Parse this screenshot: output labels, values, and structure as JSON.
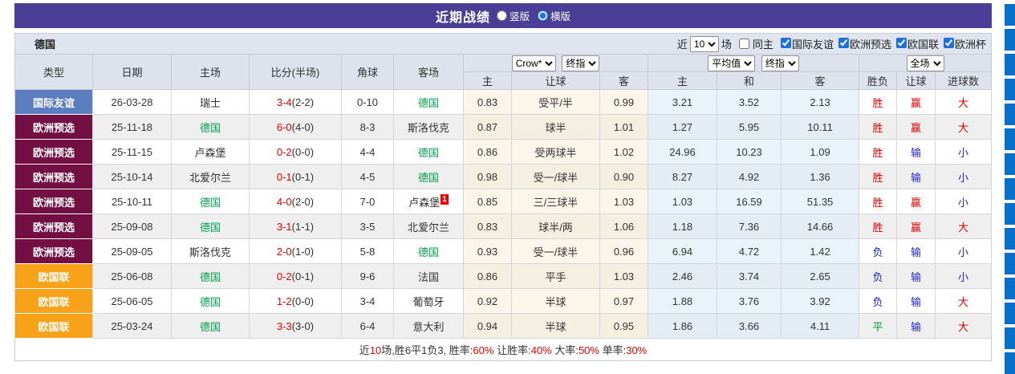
{
  "header": {
    "title": "近期战绩",
    "radio_vertical": "竖版",
    "radio_horizontal": "横版",
    "selected": "横版"
  },
  "filter": {
    "team": "德国",
    "recent_label": "近",
    "matches_value": "10",
    "matches_label": "场",
    "same_home": {
      "label": "同主",
      "checked": false
    },
    "leagues": [
      {
        "label": "国际友谊",
        "checked": true
      },
      {
        "label": "欧洲预选",
        "checked": true
      },
      {
        "label": "欧国联",
        "checked": true
      },
      {
        "label": "欧洲杯",
        "checked": true
      }
    ]
  },
  "table": {
    "columns": {
      "type": "类型",
      "date": "日期",
      "home": "主场",
      "score": "比分(半场)",
      "corner": "角球",
      "away": "客场"
    },
    "group_selects": {
      "bookmaker": "Crow*",
      "final1": "终指",
      "average": "平均值",
      "final2": "终指",
      "scope": "全场"
    },
    "sub_headers": [
      "主",
      "让球",
      "客",
      "主",
      "和",
      "客",
      "胜负",
      "让球",
      "进球数"
    ],
    "type_colors": {
      "国际友谊": "#5b7ec1",
      "欧洲预选": "#740f44",
      "欧国联": "#f7a218"
    },
    "rows": [
      {
        "type": "国际友谊",
        "date": "26-03-28",
        "home": "瑞士",
        "home_green": false,
        "score": "3-4",
        "half": "(2-2)",
        "corner": "0-10",
        "away": "德国",
        "away_green": true,
        "away_red_card": "",
        "odds": [
          "0.83",
          "受平/半",
          "0.99"
        ],
        "avg": [
          "3.21",
          "3.52",
          "2.13"
        ],
        "results": [
          {
            "t": "胜",
            "c": "r"
          },
          {
            "t": "赢",
            "c": "r"
          },
          {
            "t": "大",
            "c": "r"
          }
        ]
      },
      {
        "type": "欧洲预选",
        "date": "25-11-18",
        "home": "德国",
        "home_green": true,
        "score": "6-0",
        "half": "(4-0)",
        "corner": "8-3",
        "away": "斯洛伐克",
        "away_green": false,
        "away_red_card": "",
        "odds": [
          "0.87",
          "球半",
          "1.01"
        ],
        "avg": [
          "1.27",
          "5.95",
          "10.11"
        ],
        "results": [
          {
            "t": "胜",
            "c": "r"
          },
          {
            "t": "赢",
            "c": "r"
          },
          {
            "t": "大",
            "c": "r"
          }
        ]
      },
      {
        "type": "欧洲预选",
        "date": "25-11-15",
        "home": "卢森堡",
        "home_green": false,
        "score": "0-2",
        "half": "(0-0)",
        "corner": "4-4",
        "away": "德国",
        "away_green": true,
        "away_red_card": "",
        "odds": [
          "0.86",
          "受两球半",
          "1.02"
        ],
        "avg": [
          "24.96",
          "10.23",
          "1.09"
        ],
        "results": [
          {
            "t": "胜",
            "c": "r"
          },
          {
            "t": "输",
            "c": "b"
          },
          {
            "t": "小",
            "c": "b"
          }
        ]
      },
      {
        "type": "欧洲预选",
        "date": "25-10-14",
        "home": "北爱尔兰",
        "home_green": false,
        "score": "0-1",
        "half": "(0-1)",
        "corner": "4-5",
        "away": "德国",
        "away_green": true,
        "away_red_card": "",
        "odds": [
          "0.98",
          "受一/球半",
          "0.90"
        ],
        "avg": [
          "8.27",
          "4.92",
          "1.36"
        ],
        "results": [
          {
            "t": "胜",
            "c": "r"
          },
          {
            "t": "输",
            "c": "b"
          },
          {
            "t": "小",
            "c": "b"
          }
        ]
      },
      {
        "type": "欧洲预选",
        "date": "25-10-11",
        "home": "德国",
        "home_green": true,
        "score": "4-0",
        "half": "(2-0)",
        "corner": "7-0",
        "away": "卢森堡",
        "away_green": false,
        "away_red_card": "1",
        "odds": [
          "0.85",
          "三/三球半",
          "1.03"
        ],
        "avg": [
          "1.03",
          "16.59",
          "51.35"
        ],
        "results": [
          {
            "t": "胜",
            "c": "r"
          },
          {
            "t": "赢",
            "c": "r"
          },
          {
            "t": "小",
            "c": "b"
          }
        ]
      },
      {
        "type": "欧洲预选",
        "date": "25-09-08",
        "home": "德国",
        "home_green": true,
        "score": "3-1",
        "half": "(1-1)",
        "corner": "3-5",
        "away": "北爱尔兰",
        "away_green": false,
        "away_red_card": "",
        "odds": [
          "0.83",
          "球半/两",
          "1.06"
        ],
        "avg": [
          "1.18",
          "7.36",
          "14.66"
        ],
        "results": [
          {
            "t": "胜",
            "c": "r"
          },
          {
            "t": "赢",
            "c": "r"
          },
          {
            "t": "大",
            "c": "r"
          }
        ]
      },
      {
        "type": "欧洲预选",
        "date": "25-09-05",
        "home": "斯洛伐克",
        "home_green": false,
        "score": "2-0",
        "half": "(1-0)",
        "corner": "5-8",
        "away": "德国",
        "away_green": true,
        "away_red_card": "",
        "odds": [
          "0.93",
          "受一/球半",
          "0.96"
        ],
        "avg": [
          "6.94",
          "4.72",
          "1.42"
        ],
        "results": [
          {
            "t": "负",
            "c": "b"
          },
          {
            "t": "输",
            "c": "b"
          },
          {
            "t": "小",
            "c": "b"
          }
        ]
      },
      {
        "type": "欧国联",
        "date": "25-06-08",
        "home": "德国",
        "home_green": true,
        "score": "0-2",
        "half": "(0-1)",
        "corner": "9-6",
        "away": "法国",
        "away_green": false,
        "away_red_card": "",
        "odds": [
          "0.86",
          "平手",
          "1.03"
        ],
        "avg": [
          "2.46",
          "3.74",
          "2.65"
        ],
        "results": [
          {
            "t": "负",
            "c": "b"
          },
          {
            "t": "输",
            "c": "b"
          },
          {
            "t": "小",
            "c": "b"
          }
        ]
      },
      {
        "type": "欧国联",
        "date": "25-06-05",
        "home": "德国",
        "home_green": true,
        "score": "1-2",
        "half": "(0-0)",
        "corner": "3-4",
        "away": "葡萄牙",
        "away_green": false,
        "away_red_card": "",
        "odds": [
          "0.92",
          "半球",
          "0.97"
        ],
        "avg": [
          "1.88",
          "3.76",
          "3.92"
        ],
        "results": [
          {
            "t": "负",
            "c": "b"
          },
          {
            "t": "输",
            "c": "b"
          },
          {
            "t": "大",
            "c": "r"
          }
        ]
      },
      {
        "type": "欧国联",
        "date": "25-03-24",
        "home": "德国",
        "home_green": true,
        "score": "3-3",
        "half": "(3-0)",
        "corner": "6-4",
        "away": "意大利",
        "away_green": false,
        "away_red_card": "",
        "odds": [
          "0.94",
          "半球",
          "0.95"
        ],
        "avg": [
          "1.86",
          "3.66",
          "4.11"
        ],
        "results": [
          {
            "t": "平",
            "c": "g"
          },
          {
            "t": "输",
            "c": "b"
          },
          {
            "t": "大",
            "c": "r"
          }
        ]
      }
    ]
  },
  "summary": {
    "segments": [
      {
        "t": "近",
        "c": "k"
      },
      {
        "t": "10",
        "c": "r"
      },
      {
        "t": "场,胜6平1负3, 胜率:",
        "c": "k"
      },
      {
        "t": "60%",
        "c": "r"
      },
      {
        "t": " 让胜率:",
        "c": "k"
      },
      {
        "t": "40%",
        "c": "r"
      },
      {
        "t": " 大率:",
        "c": "k"
      },
      {
        "t": "50%",
        "c": "r"
      },
      {
        "t": " 单率:",
        "c": "k"
      },
      {
        "t": "30%",
        "c": "r"
      }
    ]
  },
  "colors": {
    "title_bar": "#4b3e97",
    "germany_green": "#00a050",
    "score_red": "#e60000",
    "win_red": "#e60000",
    "loss_blue": "#2323cc",
    "draw_green": "#009933",
    "side_strip_blue": "#0a6fc8"
  },
  "side_strip": {
    "blocks": 15
  }
}
